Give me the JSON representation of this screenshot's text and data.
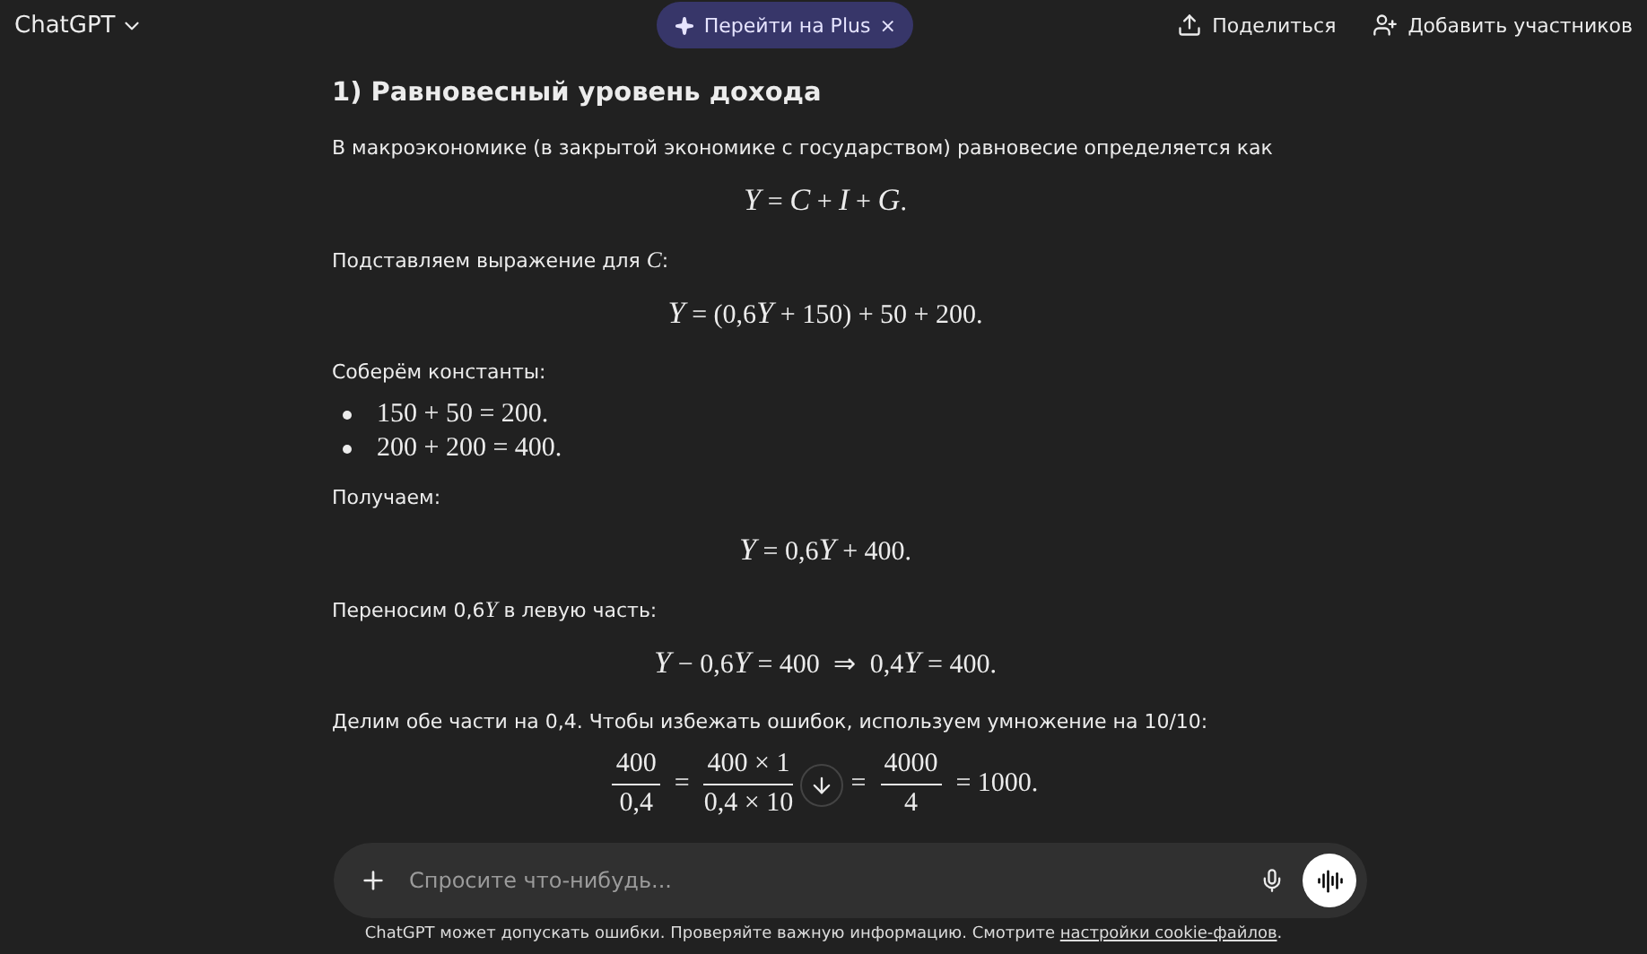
{
  "header": {
    "title": "ChatGPT",
    "promo": "Перейти на Plus",
    "promo_close": "×",
    "share": "Поделиться",
    "add_people": "Добавить участников"
  },
  "blocks": [
    {
      "kind": "heading",
      "text": "1) Равновесный уровень дохода"
    },
    {
      "kind": "paragraph",
      "text": "В макроэкономике (в закрытой экономике с государством) равновесие определяется как"
    },
    {
      "kind": "formula",
      "text": "Y = C + I + G."
    },
    {
      "kind": "paragraph",
      "text": "Подставляем выражение для C:"
    },
    {
      "kind": "formula",
      "text": "Y = (0,6Y + 150) + 50 + 200."
    },
    {
      "kind": "paragraph",
      "text": "Соберём константы:"
    },
    {
      "kind": "bullets",
      "items": [
        "150 + 50 = 200.",
        "200 + 200 = 400."
      ]
    },
    {
      "kind": "paragraph",
      "text": "Получаем:"
    },
    {
      "kind": "formula",
      "text": "Y = 0,6Y + 400."
    },
    {
      "kind": "paragraph",
      "text": "Переносим 0,6Y в левую часть:"
    },
    {
      "kind": "formula",
      "text": "Y − 0,6Y = 400  ⇒  0,4Y = 400."
    },
    {
      "kind": "paragraph",
      "text": "Делим обе части на 0,4. Чтобы избежать ошибок, используем умножение на 10/10:"
    },
    {
      "kind": "fractions",
      "parts": [
        {
          "kind": "fraction",
          "num": "400",
          "den": "0,4"
        },
        {
          "kind": "op",
          "text": "="
        },
        {
          "kind": "fraction",
          "num": "400 × 1",
          "den": "0,4 × 10"
        },
        {
          "kind": "op",
          "text": "="
        },
        {
          "kind": "fraction",
          "num": "4000",
          "den": "4"
        },
        {
          "kind": "op",
          "text": "= 1000."
        }
      ]
    }
  ],
  "composer": {
    "placeholder": "Спросите что-нибудь..."
  },
  "footer": {
    "text": "ChatGPT может допускать ошибки. Проверяйте важную информацию. Смотрите ",
    "link": "настройки cookie-файлов",
    "end": "."
  }
}
